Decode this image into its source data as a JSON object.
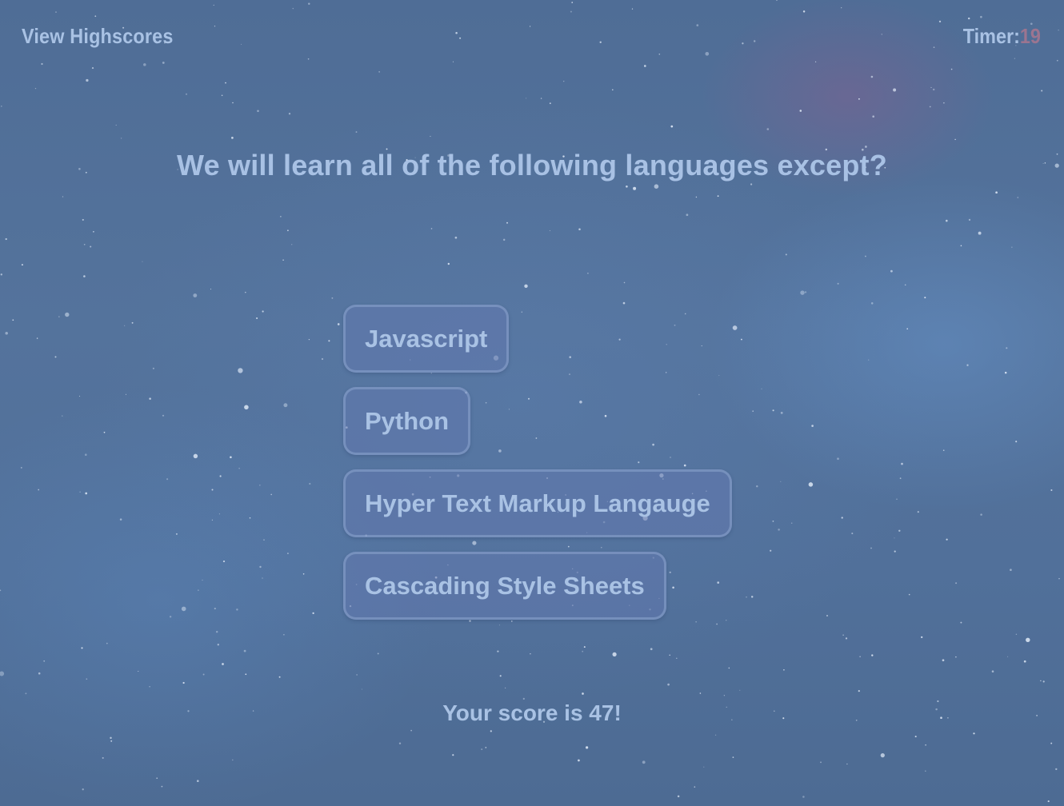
{
  "header": {
    "highscores_label": "View Highscores",
    "timer_label": "Timer:",
    "timer_value": "19"
  },
  "quiz": {
    "question": "We will learn all of the following languages except?",
    "choices": [
      {
        "label": "Javascript"
      },
      {
        "label": "Python"
      },
      {
        "label": "Hyper Text Markup Langauge"
      },
      {
        "label": "Cascading Style Sheets"
      }
    ]
  },
  "score": {
    "text": "Your score is 47!"
  },
  "colors": {
    "text": "#a9c2e4",
    "timer_value": "#9b7590",
    "background": "#52719a",
    "button_bg": "#627baf"
  }
}
